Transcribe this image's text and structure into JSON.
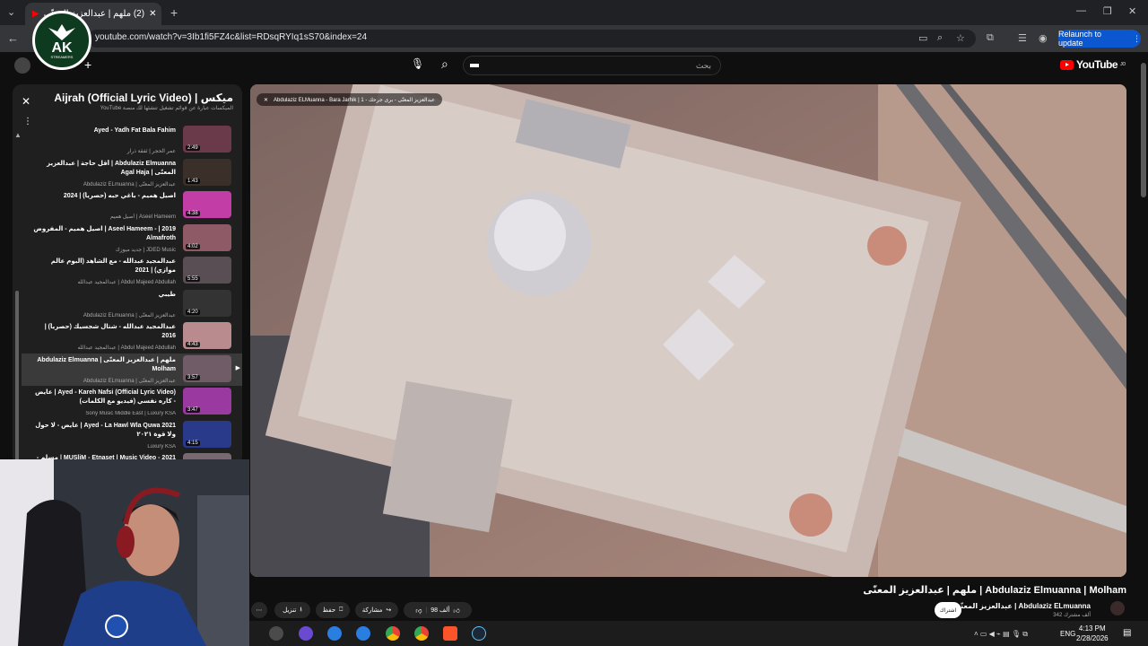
{
  "browser": {
    "tab_title": "(2) ملهم | عبدالعزيز المعنّى",
    "url": "youtube.com/watch?v=3Ib1fi5FZ4c&list=RDsqRYIq1sS70&index=24",
    "relaunch_label": "Relaunch to update"
  },
  "overlay_logo": {
    "text": "AK",
    "subtext": "STREAMERS"
  },
  "youtube": {
    "search_placeholder": "بحث",
    "logo_text": "YouTube",
    "logo_sup": "JO"
  },
  "playlist": {
    "title": "ميكس | Ayed - Aijrah (Official Lyric Video)",
    "subtitle": "الميكسات عبارة عن قوائم تشغيل تنشئها لك منصة YouTube",
    "items": [
      {
        "title": "Ayed - Yadh Fat Bala Fahim",
        "channel": "عمر الحجر | ئفقة ذرار",
        "duration": "2:49",
        "color": "#6b3a4a",
        "active": false
      },
      {
        "title": "Abdulaziz Elmuanna | أقل حاجة | عبدالعزيز المعنّى | Agal Haja",
        "channel": "عبدالعزيز المعنّى | Abdulaziz ELmuanna",
        "duration": "1:43",
        "color": "#3b2f2a",
        "active": false
      },
      {
        "title": "اصيل هميم - باغي حبه (حصرياً) | 2024",
        "channel": "Aseel Hameem | أصيل هميم",
        "duration": "4:38",
        "color": "#c23da6",
        "active": false
      },
      {
        "title": "Aseel Hameem - | 2019 | اصيل هميم - المفروض Almafroth",
        "channel": "JDED Music | جديد ميوزك",
        "duration": "4:02",
        "color": "#8e5a66",
        "active": false
      },
      {
        "title": "عبدالمجيد عبدالله - مع الشاهد (البوم عالم موازي) | 2021",
        "channel": "Abdul Majeed Abdullah | عبدالمجيد عبدالله",
        "duration": "5:55",
        "color": "#5a4e55",
        "active": false
      },
      {
        "title": "طيبي",
        "channel": "عبدالعزيز المعنّى | Abdulaziz ELmuanna",
        "duration": "4:20",
        "color": "#333333",
        "active": false
      },
      {
        "title": "عبدالمجيد عبدالله - شتال شجسيك (حصرياً) | 2016",
        "channel": "Abdul Majeed Abdullah | عبدالمجيد عبدالله",
        "duration": "4:43",
        "color": "#b98a8e",
        "active": false
      },
      {
        "title": "ملهم | عبدالعزيز المعنّى | Abdulaziz Elmuanna Molham",
        "channel": "عبدالعزيز المعنّى | Abdulaziz ELmuanna",
        "duration": "3:57",
        "color": "#6f5c66",
        "active": true
      },
      {
        "title": "Ayed - Kareh Nafsi (Official Lyric Video) | عايض - كاره نفسي (فيديو مع الكلمات)",
        "channel": "Sony Music Middle East | Luxury KSA",
        "duration": "3:47",
        "color": "#9a3aa0",
        "active": false
      },
      {
        "title": "Ayed - La Hawl Wla Quwa 2021 | عايض - لا حول ولا قوة ٢٠٢١",
        "channel": "Luxury KSA",
        "duration": "4:15",
        "color": "#2a3a8a",
        "active": false
      },
      {
        "title": "MUSliM - Etnaset | Music Video - 2021 | مسلم - اتنسيت",
        "channel": "",
        "duration": "",
        "color": "#7a6870",
        "active": false
      }
    ]
  },
  "video": {
    "chip_text": "Abdulaziz ELMuanna - Bara Jarhik | عبدالعزيز المعنّى - برى جرحك - 1",
    "title": "ملهم | عبدالعزيز المعنّى | Abdulaziz Elmuanna | Molham",
    "channel": "عبدالعزيز المعنّى | Abdulaziz ELmuanna",
    "subscribers": "342 ألف مشترك",
    "subscribe_label": "اشتراك",
    "likes_label": "98 ألف",
    "share_label": "مشاركة",
    "save_label": "حفظ",
    "download_label": "تنزيل"
  },
  "taskbar": {
    "lang": "ENG",
    "time": "4:13 PM",
    "date": "2/28/2026"
  }
}
